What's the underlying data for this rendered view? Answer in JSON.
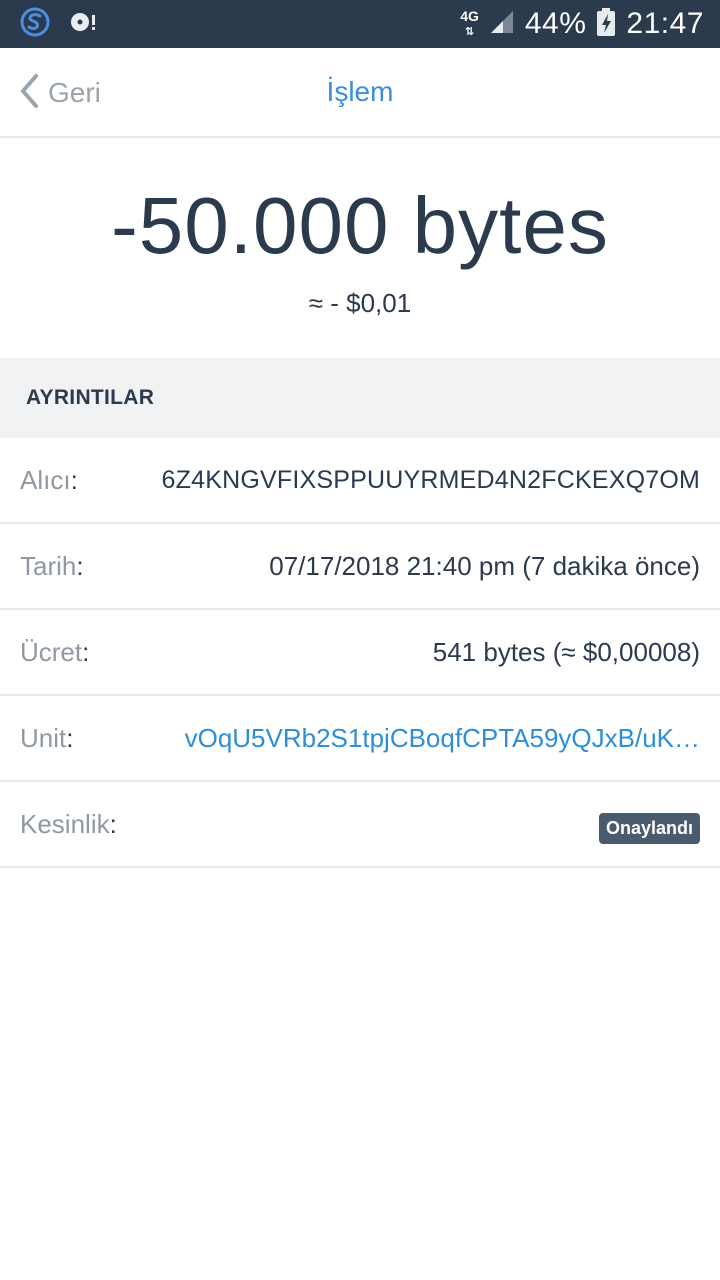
{
  "status_bar": {
    "network": "4G",
    "battery": "44%",
    "time": "21:47",
    "icons": [
      "app-s-icon",
      "disc-alert-icon",
      "signal-icon",
      "battery-charging-icon"
    ]
  },
  "header": {
    "back_label": "Geri",
    "title": "İşlem"
  },
  "transaction": {
    "amount": "-50.000 bytes",
    "fiat": "≈ - $0,01"
  },
  "details": {
    "section_title": "AYRINTILAR",
    "rows": [
      {
        "label": "Alıcı",
        "value": "6Z4KNGVFIXSPPUUYRMED4N2FCKEXQ7OM"
      },
      {
        "label": "Tarih",
        "value": "07/17/2018 21:40 pm (7 dakika önce)"
      },
      {
        "label": "Ücret",
        "value": "541 bytes (≈ $0,00008)"
      },
      {
        "label": "Unit",
        "value": "vOqU5VRb2S1tpjCBoqfCPTA59yQJxB/uK…"
      },
      {
        "label": "Kesinlik",
        "value": "Onaylandı"
      }
    ]
  },
  "colors": {
    "status_bar_bg": "#2b3a4d",
    "accent": "#3a8de0",
    "link": "#2f8fd6",
    "text_dark": "#2b3a4d",
    "text_muted": "#8e99a4",
    "badge_bg": "#4a5b6d"
  }
}
